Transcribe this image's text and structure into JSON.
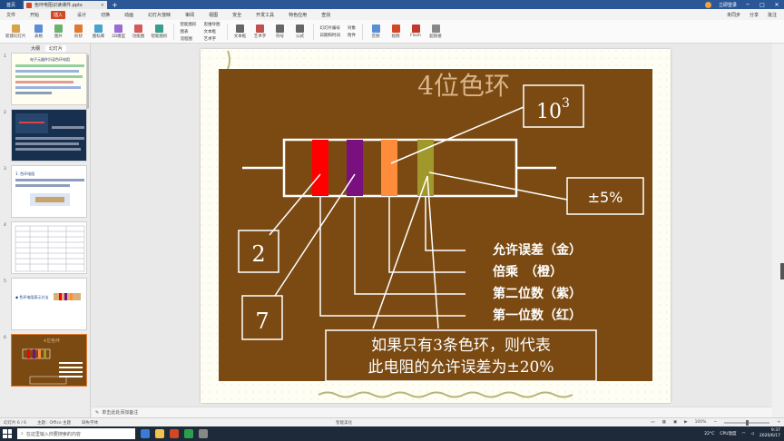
{
  "titlebar": {
    "home_tab": "首页",
    "doc_tab": "色环电阻识读课件.pptx",
    "close_glyph": "×",
    "add_glyph": "+",
    "account": "立即登录",
    "win_min": "─",
    "win_max": "□",
    "win_close": "✕"
  },
  "menubar": {
    "tabs": [
      "文件",
      "开始",
      "插入",
      "设计",
      "切换",
      "动画",
      "幻灯片放映",
      "审阅",
      "视图",
      "安全",
      "开发工具",
      "特色应用",
      "查找"
    ],
    "active_index": 2,
    "right": [
      "未同步",
      "分享",
      "批注"
    ]
  },
  "ribbon": {
    "items": [
      {
        "label": "新建幻灯片",
        "color": "#d8a24a"
      },
      {
        "label": "表格",
        "color": "#5a8fd4"
      },
      {
        "label": "图片",
        "color": "#6bb26b"
      },
      {
        "label": "形状",
        "color": "#e07a2e"
      },
      {
        "label": "图标库",
        "color": "#4aa3c9"
      },
      {
        "label": "3D模型",
        "color": "#9a6bd4"
      },
      {
        "label": "功能图",
        "color": "#d45a5a"
      },
      {
        "label": "智能图形",
        "color": "#3a9e8a"
      }
    ],
    "col1": [
      "智能图形",
      "图表",
      "流程图"
    ],
    "col2": [
      "思维导图",
      "文本框",
      "艺术字"
    ],
    "items2": [
      {
        "label": "文本框",
        "color": "#666"
      },
      {
        "label": "艺术字",
        "color": "#c0504d"
      },
      {
        "label": "符号",
        "color": "#666"
      },
      {
        "label": "公式",
        "color": "#666"
      }
    ],
    "col3": [
      "幻灯片编号",
      "日期和时间"
    ],
    "col4": [
      "对象",
      "附件"
    ],
    "items3": [
      {
        "label": "音频",
        "color": "#5a8fd4"
      },
      {
        "label": "视频",
        "color": "#d24726"
      },
      {
        "label": "Flash",
        "color": "#c0392b"
      },
      {
        "label": "超链接",
        "color": "#888"
      }
    ]
  },
  "leftpanel": {
    "tabs": [
      "大纲",
      "幻灯片"
    ],
    "active_tab": 1,
    "slide_numbers": [
      "1",
      "2",
      "3",
      "4",
      "5",
      "6"
    ],
    "thumb_texts": {
      "s1": "电子元器件识读色环电阻",
      "s3": "1. 色环电阻",
      "s5": "◆ 色环电阻表示方法",
      "s6": "4位色环"
    },
    "selected_index": 5
  },
  "slide": {
    "title": "4位色环",
    "box_103_base": "10",
    "box_103_exp": "3",
    "tolerance_box": "±5%",
    "digit2": "2",
    "digit7": "7",
    "labels": [
      "允许误差（金）",
      "倍乘　（橙）",
      "第二位数（紫）",
      "第一位数（红）"
    ],
    "note_line1": "如果只有3条色环，则代表",
    "note_line2": "此电阻的允许误差为±20%"
  },
  "colors": {
    "slide_bg": "#7a4a12",
    "band1": "#ff0000",
    "band2": "#7a1080",
    "band3": "#ff8c3a",
    "band4": "#a0982a",
    "title": "#d9b48a"
  },
  "notes": {
    "placeholder": "单击此处添加备注"
  },
  "statusbar": {
    "slide_info": "幻灯片 6 / 6",
    "theme": "主题：Office 主题",
    "missing_font": "缺失字体",
    "beautify": "智能美化",
    "zoom": "100%"
  },
  "taskbar": {
    "search": "在这里输入你要搜索的内容",
    "temp": "22°C",
    "cpu": "CPU温度",
    "time": "9:37",
    "date": "2020/6/17"
  }
}
